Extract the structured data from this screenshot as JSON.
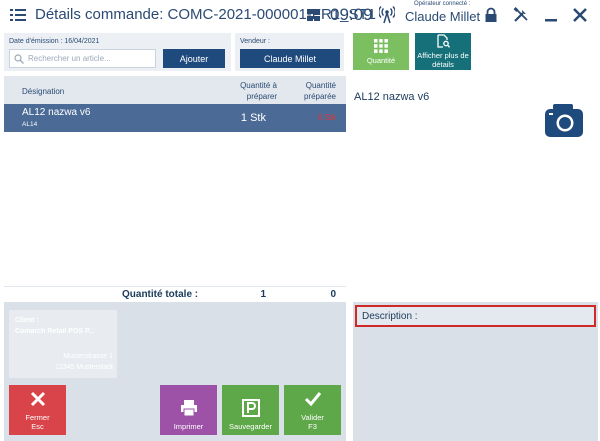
{
  "titlebar": {
    "title": "Détails commande: COMC-2021-000001-FR1_ST1",
    "time": "09:09",
    "operator_label": "Opérateur connecté :",
    "operator_name": "Claude Millet"
  },
  "header": {
    "date_label": "Date d'émission : 16/04/2021",
    "search_placeholder": "Rechercher un article...",
    "add_button": "Ajouter",
    "vendor_label": "Vendeur :",
    "vendor_name": "Claude Millet"
  },
  "table": {
    "columns": {
      "designation": "Désignation",
      "qty_to_prepare": "Quantité à préparer",
      "qty_prepared": "Quantité préparée"
    },
    "rows": [
      {
        "name": "AL12 nazwa v6",
        "code": "AL14",
        "qty": "1 Stk",
        "qty_prepared": "0 Stk"
      }
    ],
    "total_label": "Quantité totale :",
    "total_to_prepare": "1",
    "total_prepared": "0"
  },
  "client": {
    "label": "Client :",
    "name": "Comarch Retail POS P...",
    "street": "Musterstrasse 1",
    "city": "12345 Musterstadt"
  },
  "actions": {
    "close_label": "Fermer",
    "close_key": "Esc",
    "print_label": "Imprimer",
    "save_label": "Sauvegarder",
    "validate_label": "Valider",
    "validate_key": "F3"
  },
  "right": {
    "qty_button": "Quantité",
    "more_button": "Afficher plus de détails",
    "product_title": "AL12 nazwa v6",
    "description_label": "Description :"
  },
  "colors": {
    "primary_blue": "#1f4a7d",
    "selected_row": "#4b6b96",
    "close_red": "#d9444a",
    "print_purple": "#9d52a8",
    "save_green": "#5ea84a",
    "details_teal": "#16707a",
    "highlight_red": "#d02828"
  },
  "icons": {
    "menu": "hamburger-icon",
    "layout": "windows-grid-icon",
    "network": "antenna-signal-icon",
    "lock": "lock-icon",
    "tools": "tools-icon",
    "minimize": "minimize-icon",
    "close": "close-icon",
    "search": "search-icon",
    "camera": "camera-icon"
  }
}
